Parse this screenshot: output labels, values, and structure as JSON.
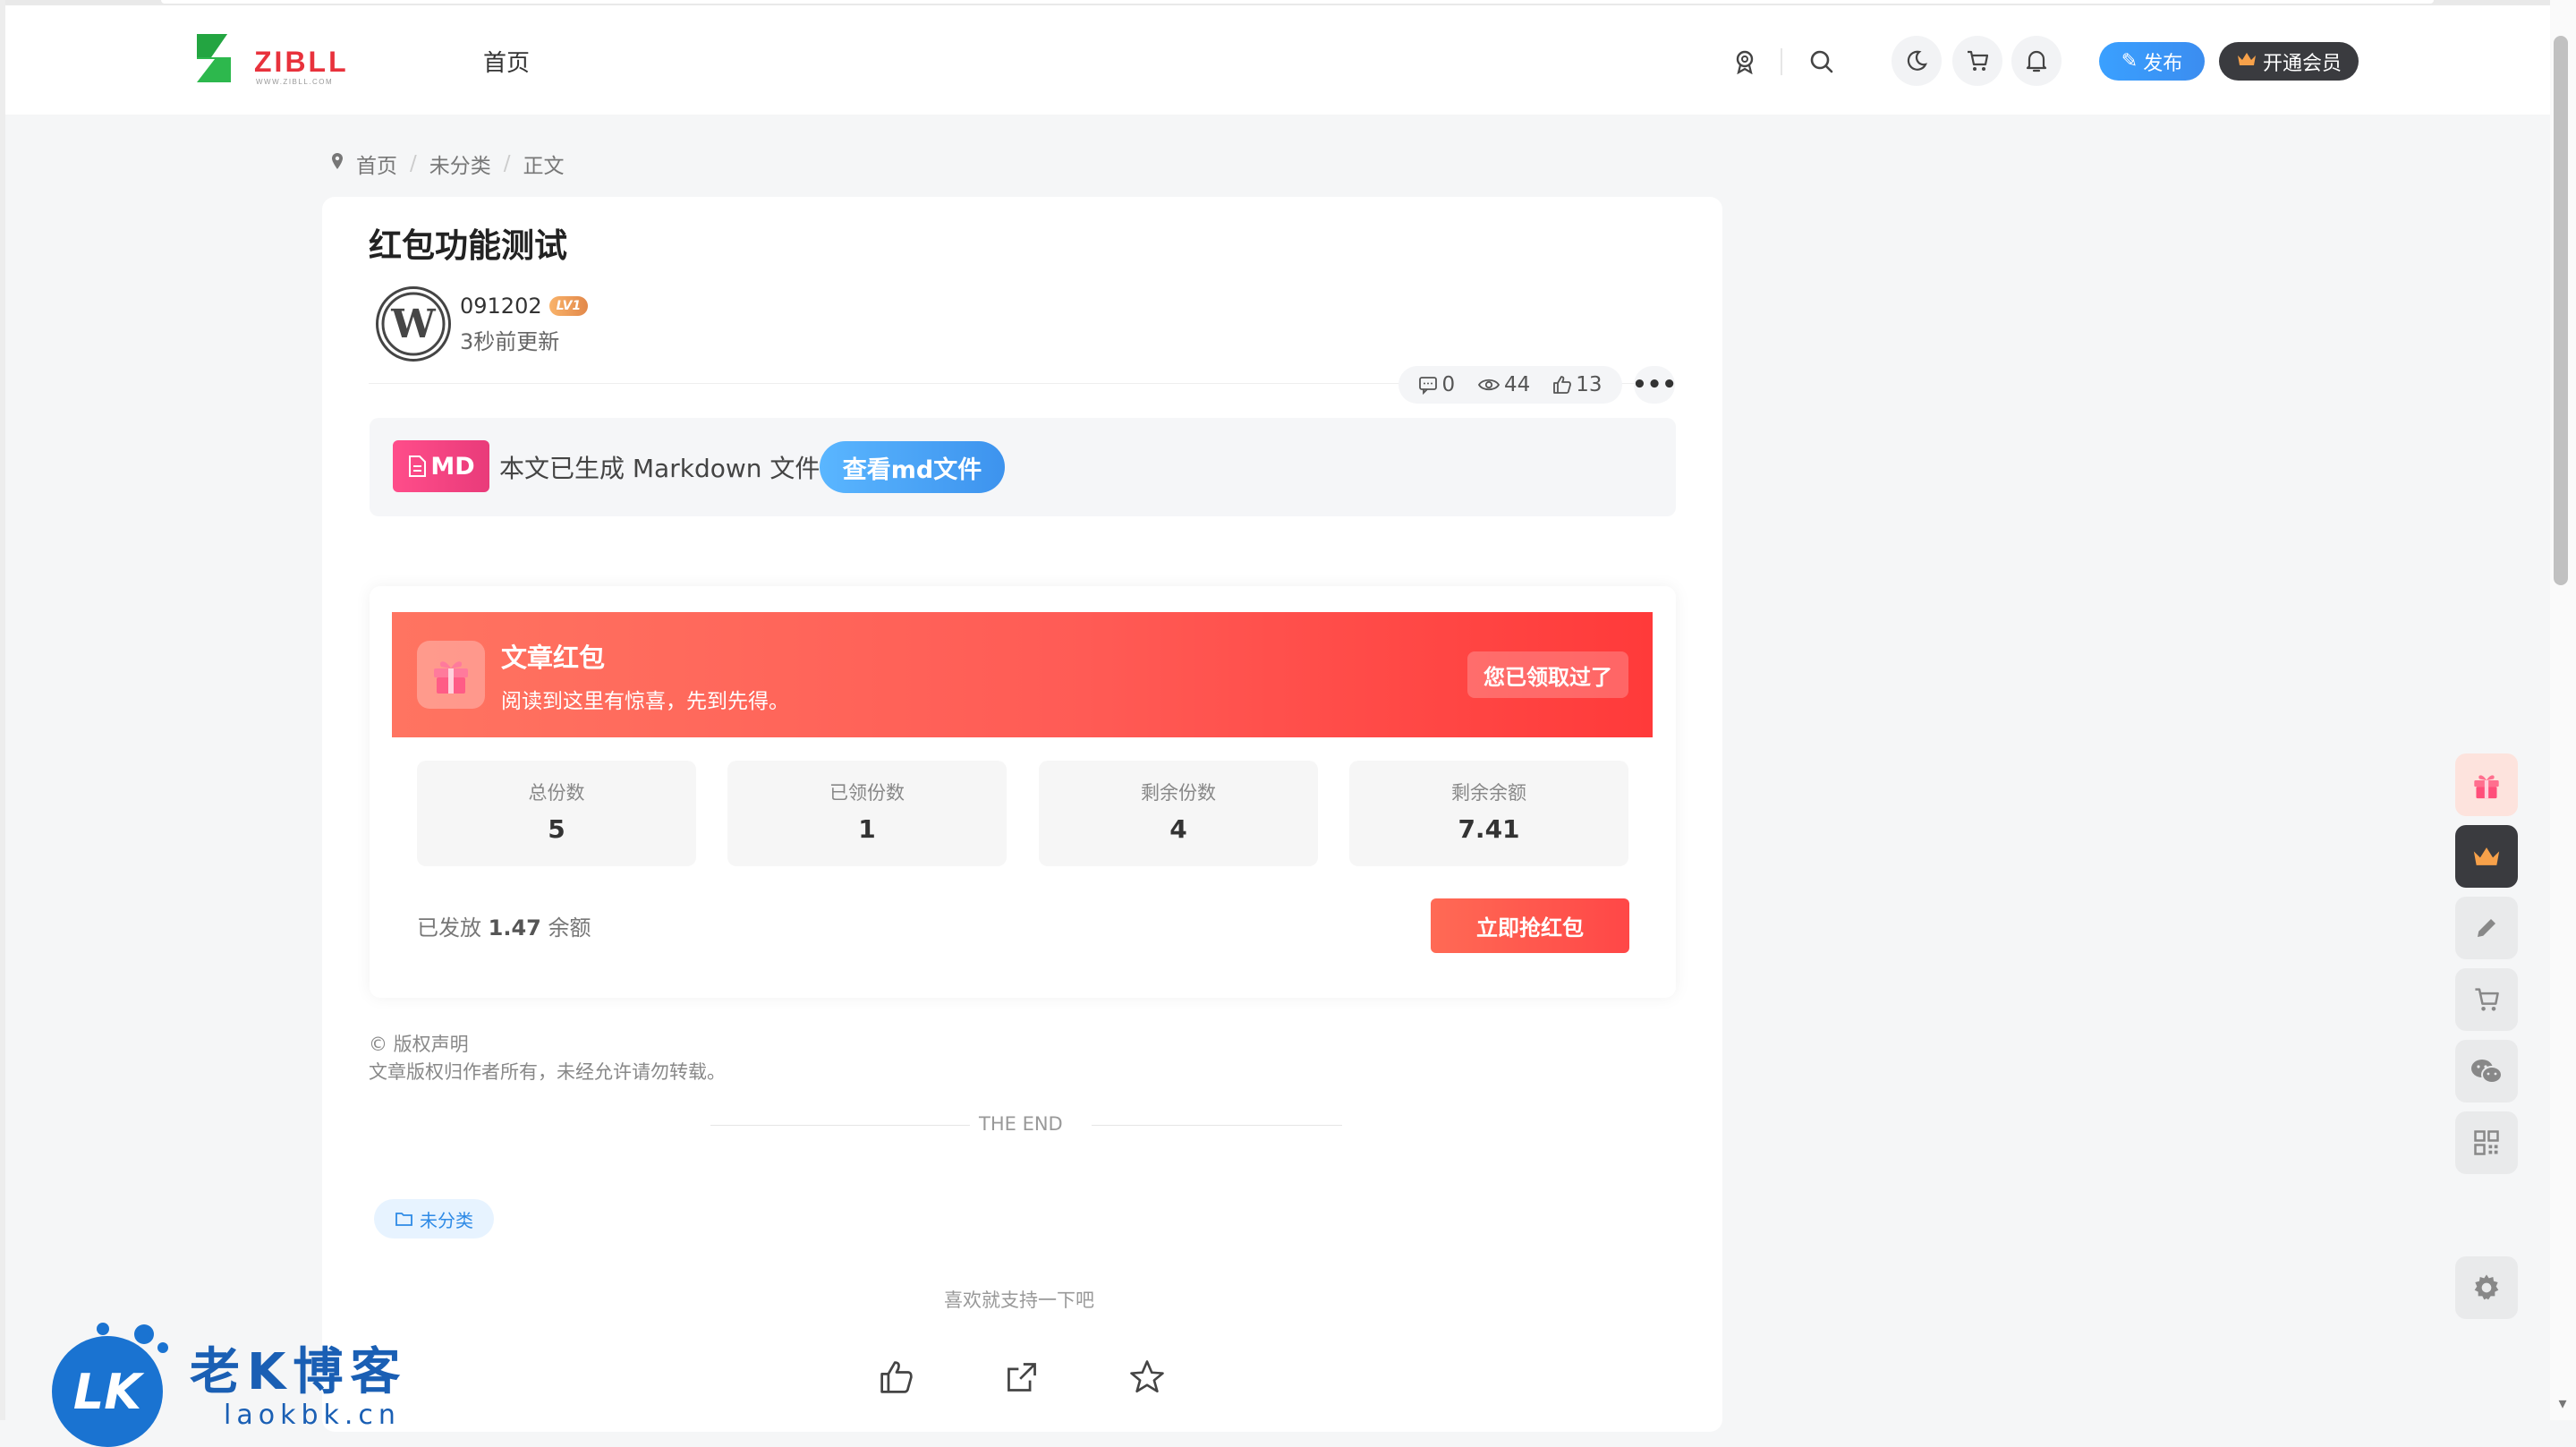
{
  "header": {
    "logo_text": "ZIBLL",
    "logo_sub": "WWW.ZIBLL.COM",
    "nav_home": "首页",
    "publish_label": "发布",
    "vip_label": "开通会员"
  },
  "breadcrumb": {
    "items": [
      "首页",
      "未分类",
      "正文"
    ]
  },
  "article": {
    "title": "红包功能测试",
    "author": "091202",
    "level": "LV1",
    "updated": "3秒前更新",
    "comments": "0",
    "views": "44",
    "likes": "13"
  },
  "markdown": {
    "badge": "MD",
    "text": "本文已生成 Markdown 文件",
    "button": "查看md文件"
  },
  "red_packet": {
    "title": "文章红包",
    "subtitle": "阅读到这里有惊喜，先到先得。",
    "claimed_label": "您已领取过了",
    "stats": [
      {
        "label": "总份数",
        "value": "5"
      },
      {
        "label": "已领份数",
        "value": "1"
      },
      {
        "label": "剩余份数",
        "value": "4"
      },
      {
        "label": "剩余余额",
        "value": "7.41"
      }
    ],
    "sent_prefix": "已发放",
    "sent_amount": "1.47",
    "sent_suffix": "余额",
    "grab_label": "立即抢红包"
  },
  "copyright": {
    "title": "© 版权声明",
    "text": "文章版权归作者所有，未经允许请勿转载。"
  },
  "the_end": "THE END",
  "tag_label": "未分类",
  "support_text": "喜欢就支持一下吧",
  "watermark": {
    "logo_letters": "LK",
    "name": "老K博客",
    "url": "laokbk.cn"
  },
  "colors": {
    "red_packet_start": "#ff7461",
    "red_packet_end": "#ff3a3a",
    "primary_blue": "#3b8df0",
    "md_pink": "#e93b7a"
  }
}
